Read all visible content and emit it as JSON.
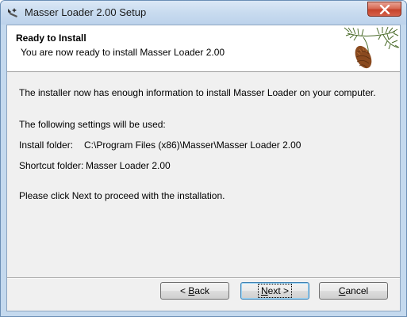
{
  "window": {
    "title": "Masser Loader 2.00 Setup"
  },
  "header": {
    "title": "Ready to Install",
    "subtitle": "You are now ready to install Masser Loader 2.00"
  },
  "body": {
    "intro": "The installer now has enough information to install Masser Loader on your computer.",
    "settings_heading": "The following settings will be used:",
    "install_folder_label": "Install folder:",
    "install_folder_value": "C:\\Program Files (x86)\\Masser\\Masser Loader 2.00",
    "shortcut_folder_label": "Shortcut folder:",
    "shortcut_folder_value": "Masser Loader 2.00",
    "instruction": "Please click Next to proceed with the installation."
  },
  "buttons": {
    "back": {
      "mnemonic": "B",
      "rest": "ack",
      "prefix": "< "
    },
    "next": {
      "mnemonic": "N",
      "rest": "ext >"
    },
    "cancel": {
      "mnemonic": "C",
      "rest": "ancel"
    }
  },
  "icons": {
    "app": "installer-wand-icon",
    "close": "close-icon",
    "header_image": "pine-cone-branch-image"
  }
}
